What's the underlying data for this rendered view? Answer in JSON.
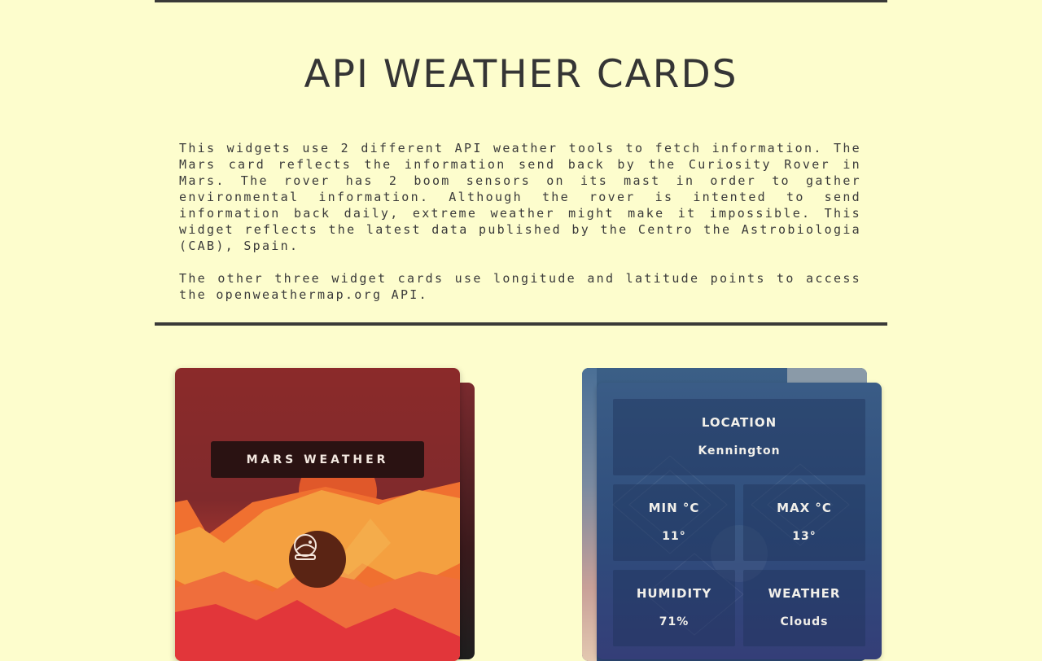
{
  "page": {
    "title": "API WEATHER CARDS",
    "intro_paragraph_1": "This widgets use 2 different API weather tools to fetch information. The Mars card reflects the information send back by the Curiosity Rover in Mars. The rover has 2 boom sensors on its mast in order to gather environmental information. Although the rover is intented to send information back daily, extreme weather might make it impossible. This widget reflects the latest data published by the Centro the Astrobiologia (CAB), Spain.",
    "intro_paragraph_2": "The other three widget cards use longitude and latitude points to access the openweathermap.org API."
  },
  "mars_card": {
    "label": "MARS WEATHER",
    "icon": "astronaut-helmet-icon"
  },
  "weather_card": {
    "location_label": "LOCATION",
    "location_value": "Kennington",
    "min_label": "MIN °C",
    "min_value": "11°",
    "max_label": "MAX °C",
    "max_value": "13°",
    "humidity_label": "HUMIDITY",
    "humidity_value": "71%",
    "weather_label": "WEATHER",
    "weather_value": "Clouds"
  },
  "colors": {
    "background": "#fdfdcd",
    "rule": "#3a3a38",
    "mars_sky": "#8b2a2a",
    "mars_label_bg": "#2a1212",
    "weather_card_bg": "#3a5c86"
  }
}
